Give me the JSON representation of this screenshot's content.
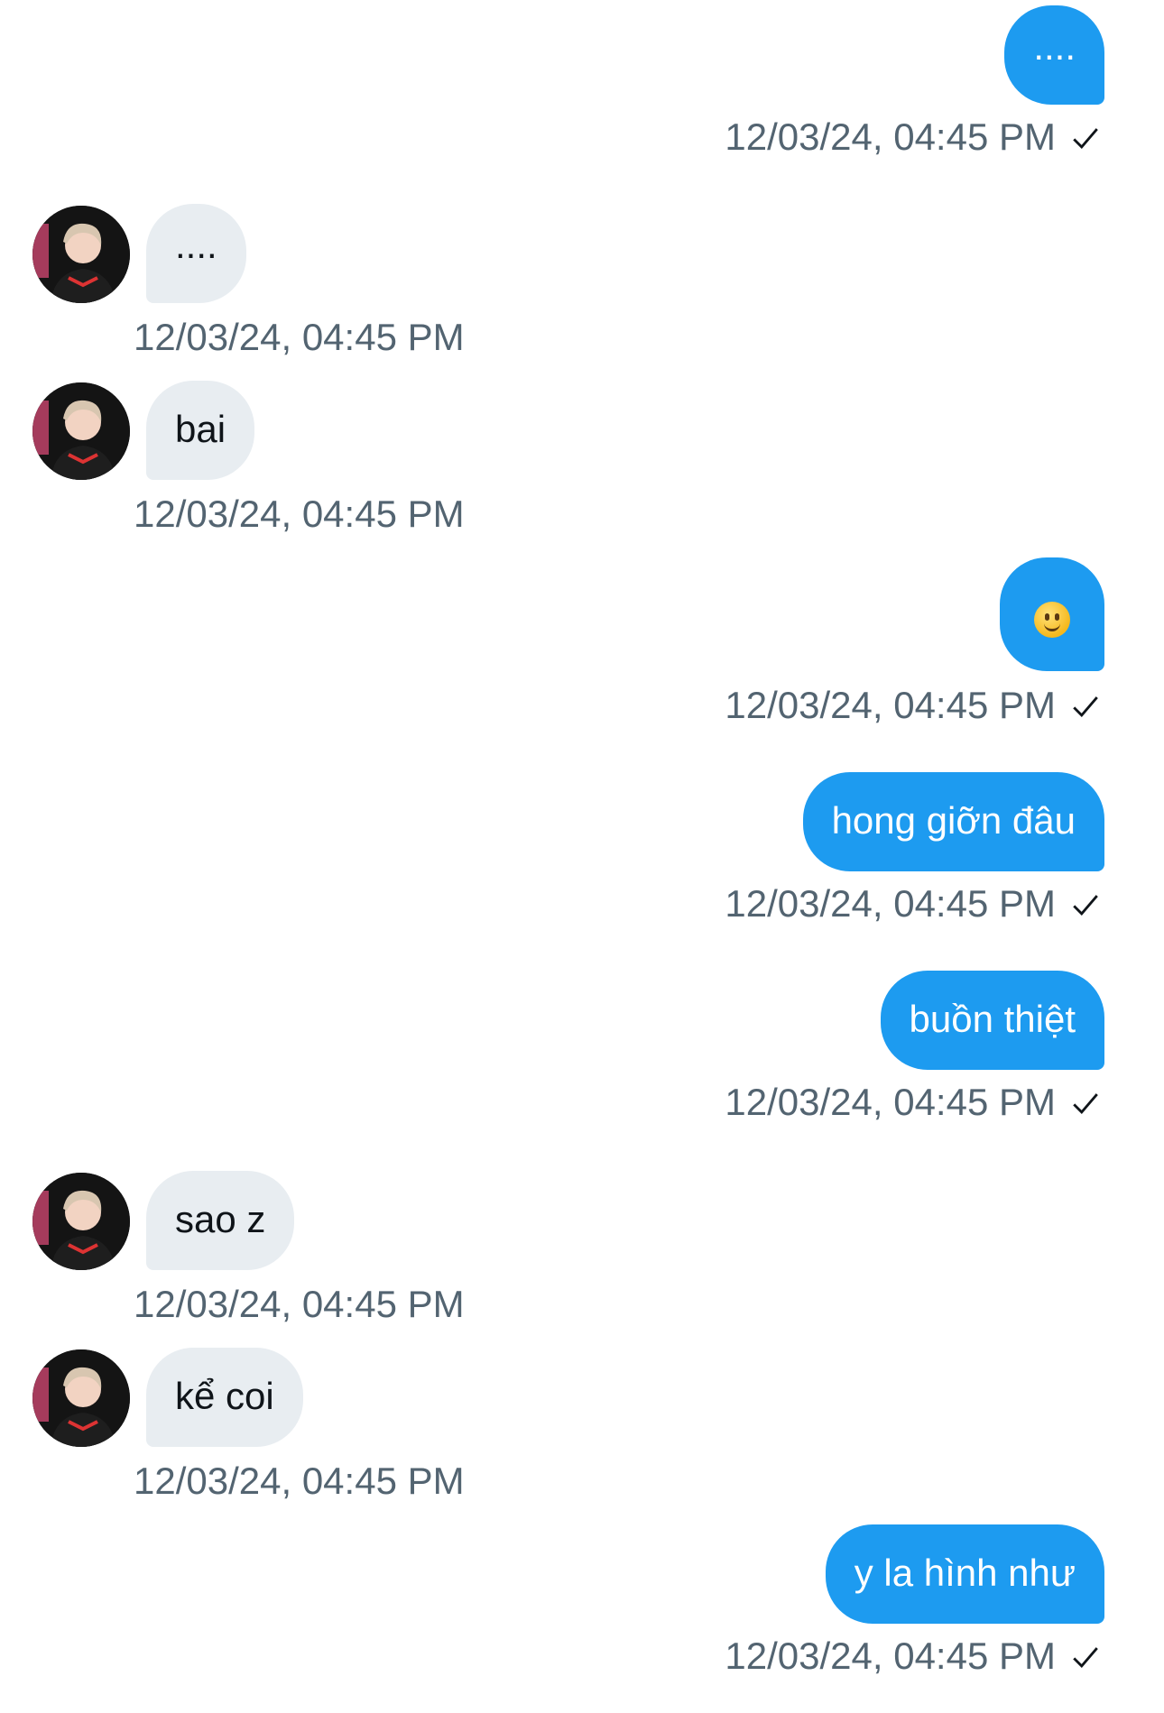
{
  "messages": [
    {
      "dir": "out",
      "text": "....",
      "time": "12/03/24, 04:45 PM"
    },
    {
      "dir": "in",
      "text": "....",
      "time": "12/03/24, 04:45 PM"
    },
    {
      "dir": "in",
      "text": "bai",
      "time": "12/03/24, 04:45 PM"
    },
    {
      "dir": "out",
      "text": "🙂",
      "emoji": "slightly-smiling-face",
      "time": "12/03/24, 04:45 PM"
    },
    {
      "dir": "out",
      "text": "hong giỡn đâu",
      "time": "12/03/24, 04:45 PM"
    },
    {
      "dir": "out",
      "text": "buồn thiệt",
      "time": "12/03/24, 04:45 PM"
    },
    {
      "dir": "in",
      "text": "sao z",
      "time": "12/03/24, 04:45 PM"
    },
    {
      "dir": "in",
      "text": "kể coi",
      "time": "12/03/24, 04:45 PM"
    },
    {
      "dir": "out",
      "text": "y la hình như",
      "time": "12/03/24, 04:45 PM"
    }
  ],
  "colors": {
    "outgoing": "#1d9bf0",
    "incoming": "#e8edf1",
    "timestamp": "#536471"
  },
  "icons": {
    "sent_status": "check-icon",
    "avatar": "contact-avatar"
  }
}
